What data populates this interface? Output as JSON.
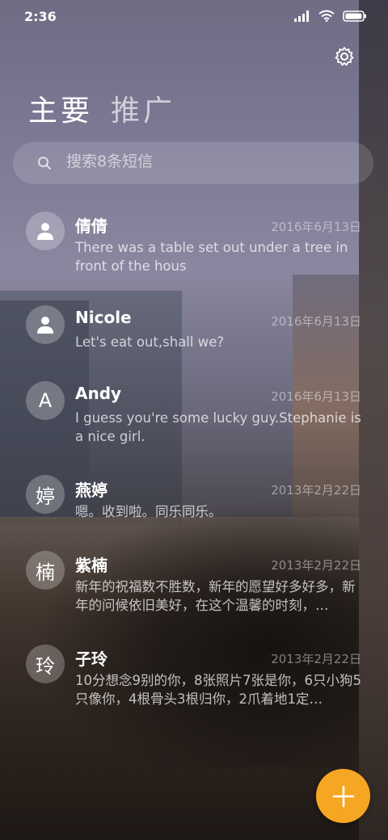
{
  "status_bar": {
    "time": "2:36"
  },
  "tabs": [
    {
      "label": "主要"
    },
    {
      "label": "推广"
    }
  ],
  "search": {
    "placeholder": "搜索8条短信"
  },
  "conversations": [
    {
      "name": "倩倩",
      "date": "2016年6月13日",
      "preview": "There was a table set out under a tree in front of the hous",
      "avatar": "person-icon"
    },
    {
      "name": "Nicole",
      "date": "2016年6月13日",
      "preview": "Let's eat out,shall we?",
      "avatar": "person-icon"
    },
    {
      "name": "Andy",
      "date": "2016年6月13日",
      "preview": "I guess you're some lucky guy.Stephanie is a nice girl.",
      "avatar_letter": "A"
    },
    {
      "name": "燕婷",
      "date": "2013年2月22日",
      "preview": "嗯。收到啦。同乐同乐。",
      "avatar_letter": "婷"
    },
    {
      "name": "紫楠",
      "date": "2013年2月22日",
      "preview": "新年的祝福数不胜数，新年的愿望好多好多，新年的问候依旧美好，在这个温馨的时刻，…",
      "avatar_letter": "楠"
    },
    {
      "name": "子玲",
      "date": "2013年2月22日",
      "preview": "10分想念9别的你，8张照片7张是你，6只小狗5只像你，4根骨头3根归你，2爪着地1定…",
      "avatar_letter": "玲"
    }
  ],
  "fab": {
    "icon": "plus-icon",
    "color": "#f5a623"
  }
}
